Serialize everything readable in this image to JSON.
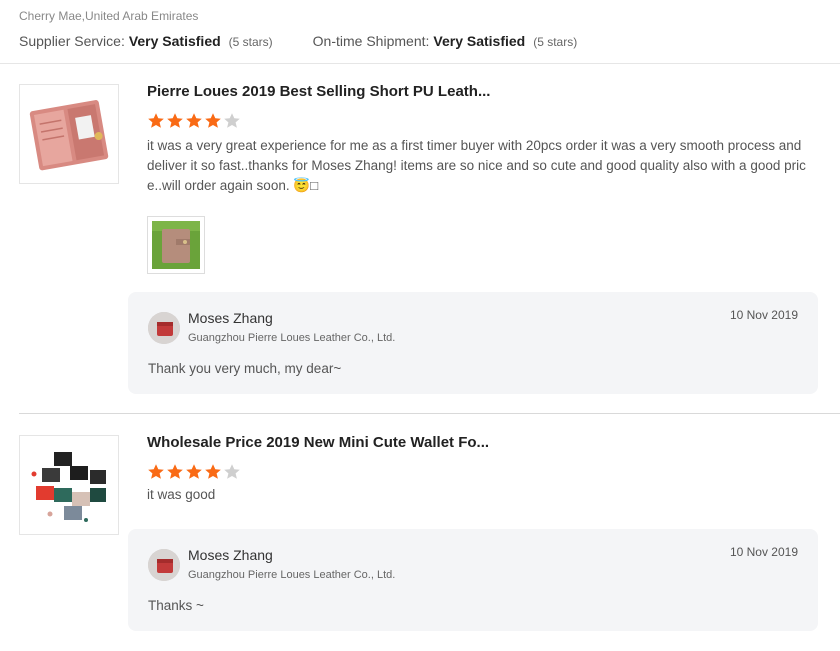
{
  "header": {
    "reviewer": "Cherry Mae,United Arab Emirates",
    "supplier_service_label": "Supplier Service:",
    "supplier_service_value": "Very Satisfied",
    "supplier_service_stars": "(5 stars)",
    "shipment_label": "On-time Shipment:",
    "shipment_value": "Very Satisfied",
    "shipment_stars": "(5 stars)"
  },
  "colors": {
    "star_filled": "#f96a15",
    "star_empty": "#cfcfcf",
    "reply_bg": "#f4f5f7"
  },
  "reviews": [
    {
      "title": "Pierre Loues 2019 Best Selling Short PU Leath...",
      "rating": 4,
      "max_rating": 5,
      "text": "it was a very great experience for me as a first timer buyer with 20pcs order it was a very smooth process and deliver it so fast..thanks for Moses Zhang! items are so nice and so cute and good quality also with a good price..will order again soon. 😇□",
      "has_photo": true,
      "reply": {
        "name": "Moses Zhang",
        "company": "Guangzhou Pierre Loues Leather Co., Ltd.",
        "date": "10 Nov 2019",
        "message": "Thank you very much, my dear~"
      }
    },
    {
      "title": "Wholesale Price 2019 New Mini Cute Wallet Fo...",
      "rating": 4,
      "max_rating": 5,
      "text": "it was good",
      "has_photo": false,
      "reply": {
        "name": "Moses Zhang",
        "company": "Guangzhou Pierre Loues Leather Co., Ltd.",
        "date": "10 Nov 2019",
        "message": "Thanks ~"
      }
    }
  ]
}
